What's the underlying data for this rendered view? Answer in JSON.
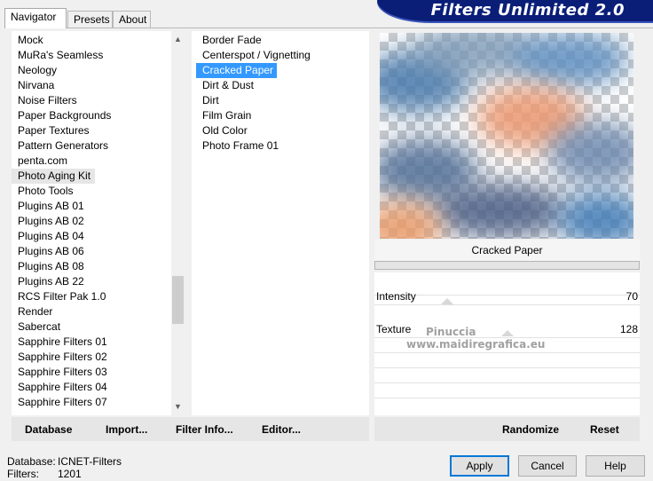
{
  "tabs": [
    {
      "label": "Navigator",
      "active": true
    },
    {
      "label": "Presets",
      "active": false
    },
    {
      "label": "About",
      "active": false
    }
  ],
  "banner": {
    "title": "Filters Unlimited 2.0"
  },
  "categories": [
    "Mock",
    "MuRa's Seamless",
    "Neology",
    "Nirvana",
    "Noise Filters",
    "Paper Backgrounds",
    "Paper Textures",
    "Pattern Generators",
    "penta.com",
    "Photo Aging Kit",
    "Photo Tools",
    "Plugins AB 01",
    "Plugins AB 02",
    "Plugins AB 04",
    "Plugins AB 06",
    "Plugins AB 08",
    "Plugins AB 22",
    "RCS Filter Pak 1.0",
    "Render",
    "Sabercat",
    "Sapphire Filters 01",
    "Sapphire Filters 02",
    "Sapphire Filters 03",
    "Sapphire Filters 04",
    "Sapphire Filters 07"
  ],
  "selected_category": "Photo Aging Kit",
  "filters": [
    "Border Fade",
    "Centerspot / Vignetting",
    "Cracked Paper",
    "Dirt & Dust",
    "Dirt",
    "Film Grain",
    "Old Color",
    "Photo Frame 01"
  ],
  "selected_filter": "Cracked Paper",
  "preview": {
    "filter_name": "Cracked Paper"
  },
  "controls": [
    {
      "label": "Intensity",
      "value": "70",
      "level": 70
    },
    {
      "label": "Texture",
      "value": "128",
      "level": 128
    }
  ],
  "watermark": {
    "line1": "Pinuccia",
    "line2": "www.maidiregrafica.eu"
  },
  "toolbar": {
    "database": "Database",
    "import": "Import...",
    "filter_info": "Filter Info...",
    "editor": "Editor...",
    "randomize": "Randomize",
    "reset": "Reset"
  },
  "status": {
    "database_label": "Database:",
    "database_value": "ICNET-Filters",
    "filters_label": "Filters:",
    "filters_value": "1201"
  },
  "buttons": {
    "apply": "Apply",
    "cancel": "Cancel",
    "help": "Help"
  },
  "colors": {
    "selection": "#3399ff",
    "banner": "#0a1e78",
    "default_button_border": "#0078d7"
  }
}
